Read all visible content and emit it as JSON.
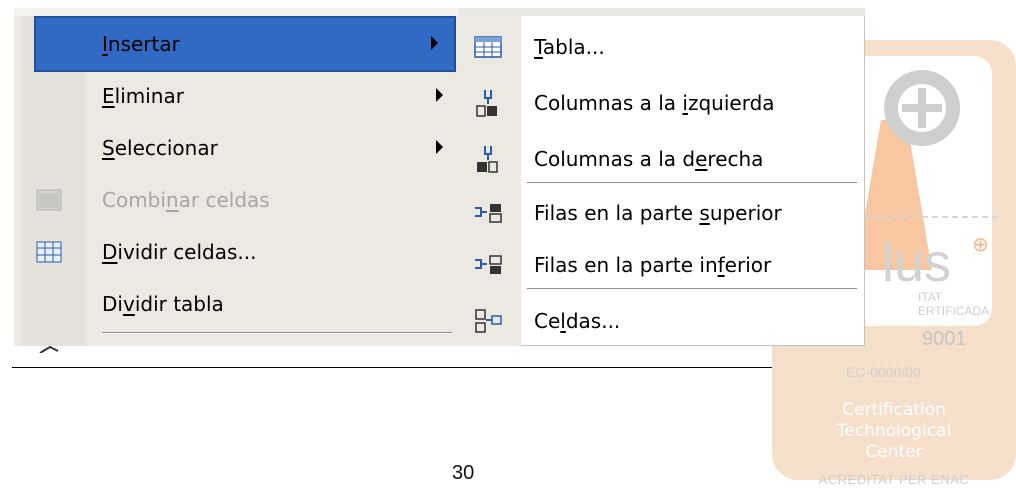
{
  "main_menu": {
    "items": [
      {
        "before": "",
        "key": "I",
        "after": "nsertar",
        "has_submenu": true,
        "highlighted": true,
        "disabled": false
      },
      {
        "before": "",
        "key": "E",
        "after": "liminar",
        "has_submenu": true,
        "highlighted": false,
        "disabled": false
      },
      {
        "before": "",
        "key": "S",
        "after": "eleccionar",
        "has_submenu": true,
        "highlighted": false,
        "disabled": false
      },
      {
        "before": "Combi",
        "key": "n",
        "after": "ar celdas",
        "has_submenu": false,
        "highlighted": false,
        "disabled": true,
        "icon": "merge-cells-icon"
      },
      {
        "before": "",
        "key": "D",
        "after": "ividir celdas...",
        "has_submenu": false,
        "highlighted": false,
        "disabled": false,
        "icon": "split-cells-icon"
      },
      {
        "before": "Di",
        "key": "v",
        "after": "idir tabla",
        "has_submenu": false,
        "highlighted": false,
        "disabled": false
      }
    ]
  },
  "insert_submenu": {
    "items": [
      {
        "before": "",
        "key": "T",
        "after": "abla...",
        "icon": "table-icon"
      },
      {
        "before": "Columnas a la ",
        "key": "i",
        "after": "zquierda",
        "icon": "insert-columns-left-icon"
      },
      {
        "before": "Columnas a la d",
        "key": "e",
        "after": "recha",
        "icon": "insert-columns-right-icon"
      },
      {
        "before": "Filas en la parte ",
        "key": "s",
        "after": "uperior",
        "icon": "insert-rows-above-icon"
      },
      {
        "before": "Filas en la parte in",
        "key": "f",
        "after": "erior",
        "icon": "insert-rows-below-icon"
      },
      {
        "before": "Ce",
        "key": "l",
        "after": "das...",
        "icon": "insert-cells-icon"
      }
    ]
  },
  "page": {
    "number": "30"
  },
  "watermark": {
    "brand_fragment": "lus",
    "small_line_1": "ITAT",
    "small_line_2": "ERTIFICADA",
    "standard_fragment": "9001",
    "code": "EC-0000/00",
    "center_line_1": "Certification",
    "center_line_2": "Technological",
    "center_line_3": "Center",
    "accreditation": "ACREDITAT PER ENAC"
  },
  "colors": {
    "highlight": "#316ac5",
    "menu_background": "#ece9e3",
    "disabled_text": "#a9a7a1",
    "watermark_orange": "#f5b98a"
  }
}
